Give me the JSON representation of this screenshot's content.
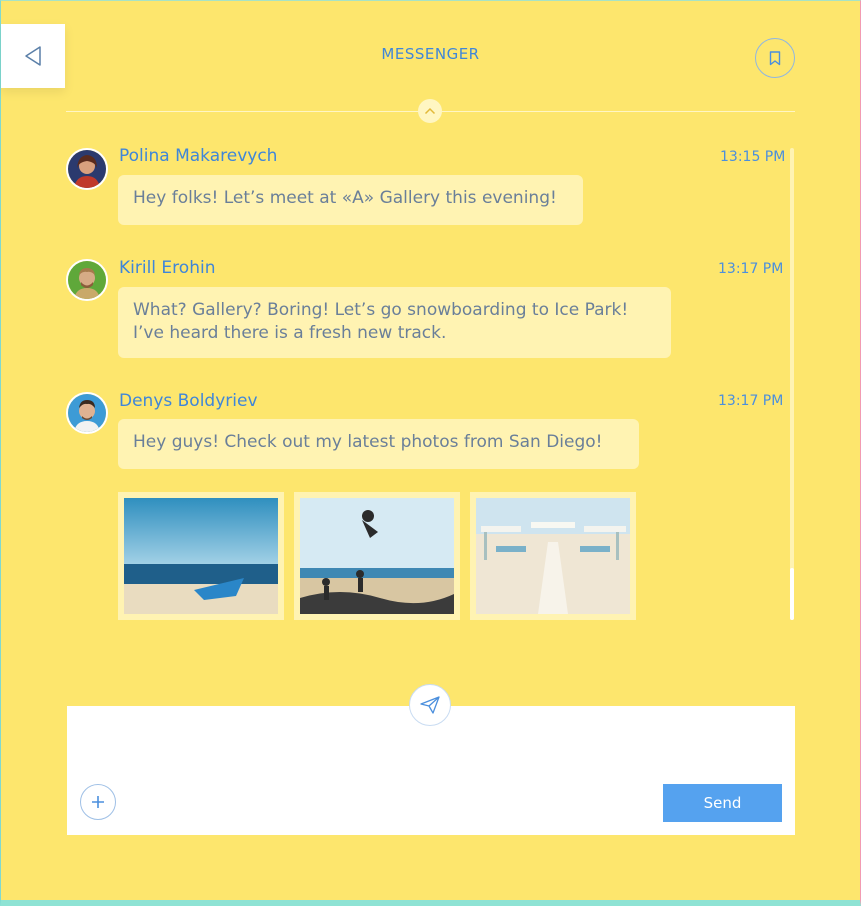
{
  "header": {
    "title": "MESSENGER"
  },
  "messages": [
    {
      "sender": "Polina Makarevych",
      "time": "13:15 PM",
      "text": "Hey folks! Let’s meet at «A» Gallery this evening!"
    },
    {
      "sender": "Kirill Erohin",
      "time": "13:17 PM",
      "text_line1": "What? Gallery? Boring! Let’s go snowboarding to Ice Park!",
      "text_line2": "I’ve heard there is a fresh new track."
    },
    {
      "sender": "Denys Boldyriev",
      "time": "13:17 PM",
      "text": "Hey guys! Check out my latest photos from San Diego!"
    }
  ],
  "photos": [
    "sea-boat-photo",
    "skateboard-beach-photo",
    "beach-cabanas-photo"
  ],
  "compose": {
    "input_value": "",
    "send_label": "Send"
  },
  "colors": {
    "background": "#fde66d",
    "accent": "#3f86d9",
    "send_button": "#55a2ef",
    "bubble": "#fff3b2"
  }
}
